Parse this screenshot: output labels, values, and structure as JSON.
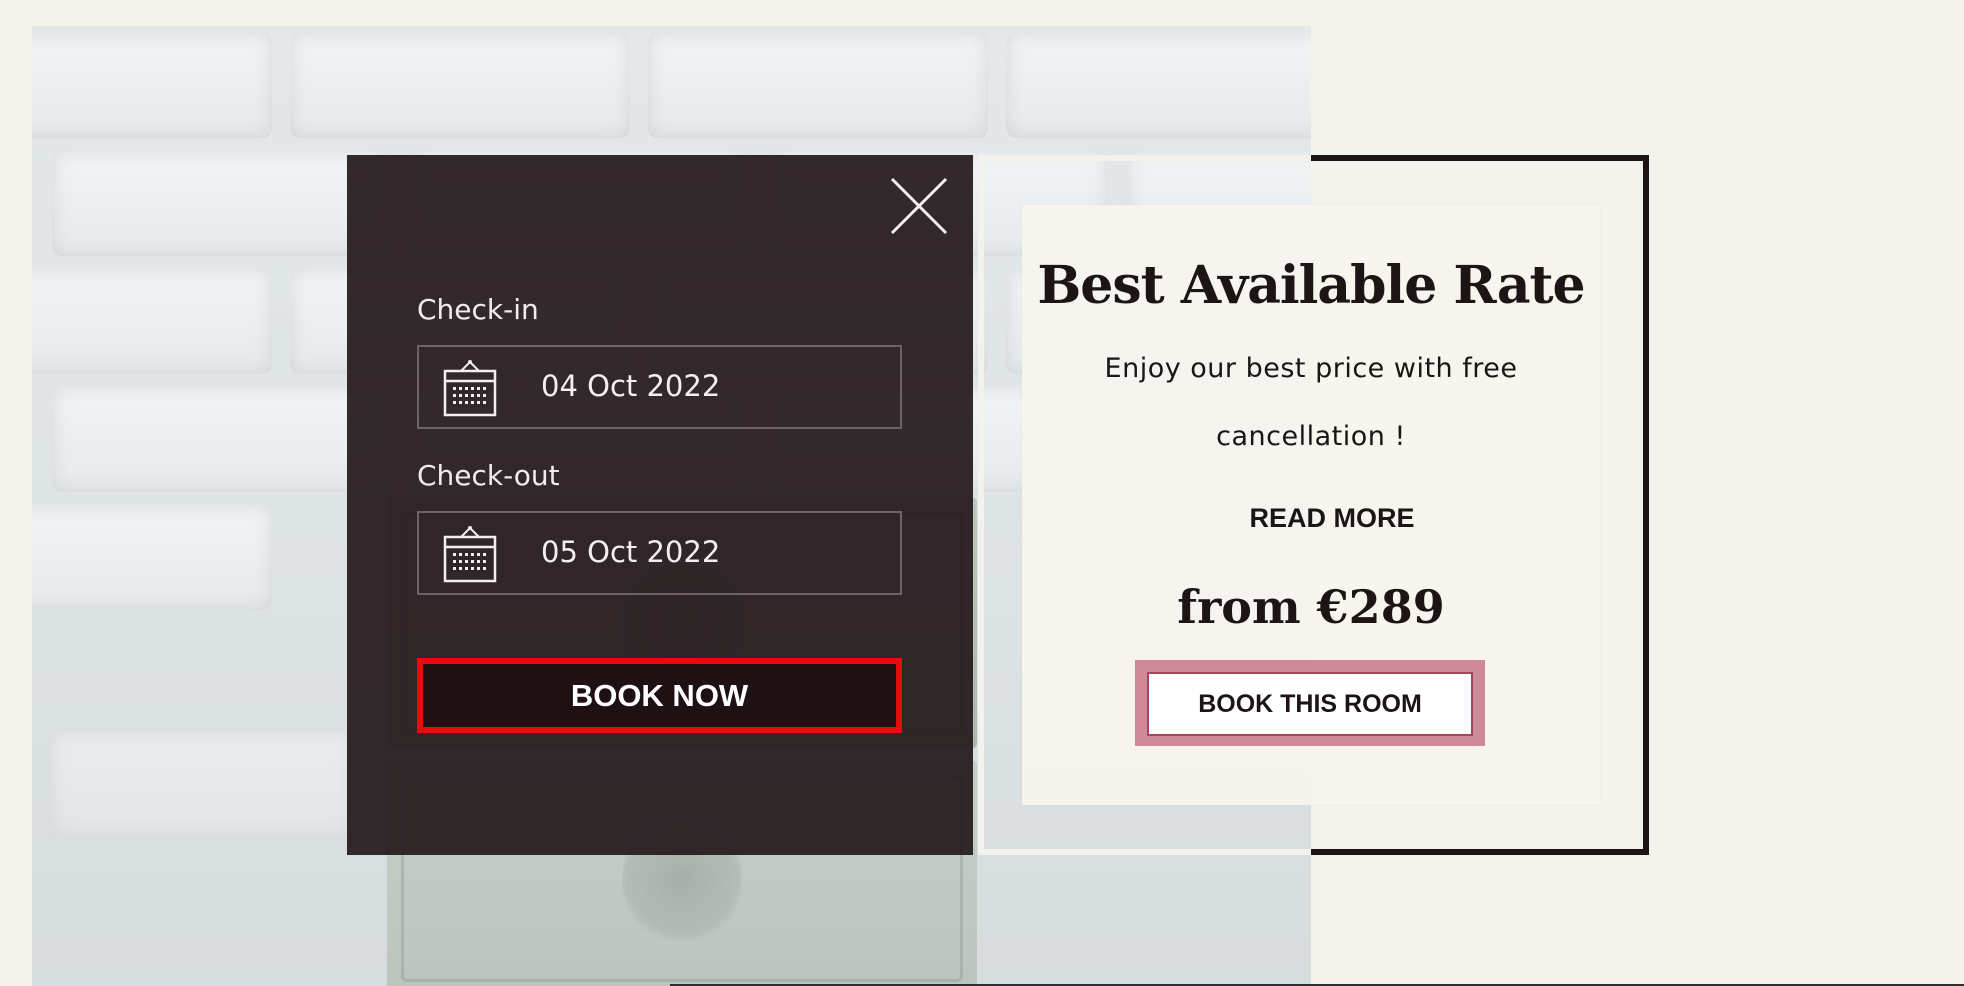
{
  "booking": {
    "checkin_label": "Check-in",
    "checkin_value": "04 Oct 2022",
    "checkout_label": "Check-out",
    "checkout_value": "05 Oct 2022",
    "book_now_label": "BOOK NOW",
    "close_icon": "close-icon",
    "calendar_icon": "calendar-icon"
  },
  "rate": {
    "title": "Best Available Rate",
    "description": "Enjoy our best price with free cancellation !",
    "read_more_label": "READ MORE",
    "price": "from €289",
    "book_room_label": "BOOK THIS ROOM"
  },
  "colors": {
    "panel_dark": "#281e21",
    "accent_red": "#e60d0d",
    "button_shadow_pink": "#cf8a99",
    "text_dark": "#1d1416",
    "page_bg": "#f4f2ec"
  }
}
